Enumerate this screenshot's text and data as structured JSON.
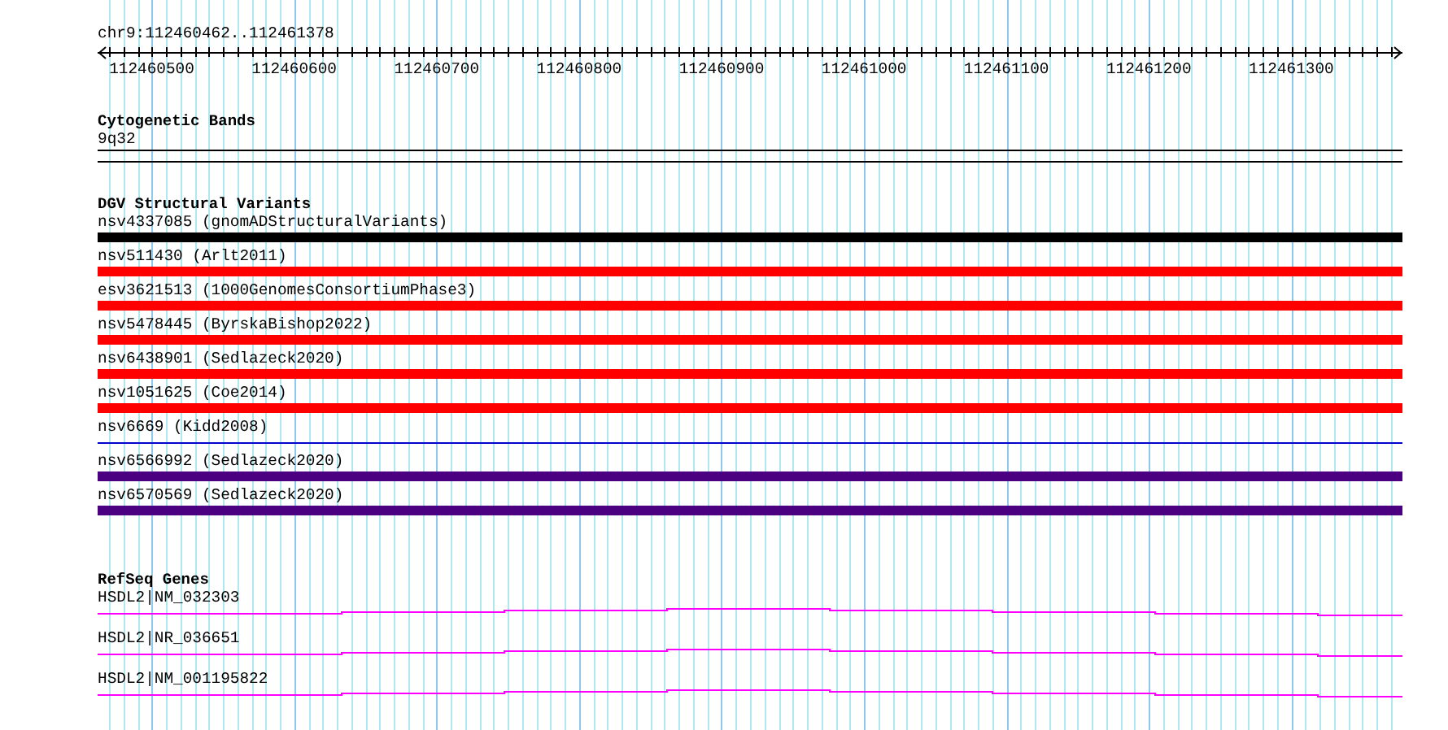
{
  "location": "chr9:112460462..112461378",
  "ruler": {
    "ticks": [
      "112460500",
      "112460600",
      "112460700",
      "112460800",
      "112460900",
      "112461000",
      "112461100",
      "112461200",
      "112461300"
    ]
  },
  "tracks": [
    {
      "kind": "bands",
      "title": "Cytogenetic Bands",
      "features": [
        {
          "label": "9q32"
        }
      ]
    },
    {
      "kind": "variants",
      "title": "DGV Structural Variants",
      "features": [
        {
          "label": "nsv4337085 (gnomADStructuralVariants)",
          "color": "#000000",
          "kind": "thick"
        },
        {
          "label": "nsv511430 (Arlt2011)",
          "color": "#ff0000",
          "kind": "thick"
        },
        {
          "label": "esv3621513 (1000GenomesConsortiumPhase3)",
          "color": "#ff0000",
          "kind": "thick"
        },
        {
          "label": "nsv5478445 (ByrskaBishop2022)",
          "color": "#ff0000",
          "kind": "thick"
        },
        {
          "label": "nsv6438901 (Sedlazeck2020)",
          "color": "#ff0000",
          "kind": "thick"
        },
        {
          "label": "nsv1051625 (Coe2014)",
          "color": "#ff0000",
          "kind": "thick"
        },
        {
          "label": "nsv6669 (Kidd2008)",
          "color": "#0000cc",
          "kind": "thin"
        },
        {
          "label": "nsv6566992 (Sedlazeck2020)",
          "color": "#4b0082",
          "kind": "thick"
        },
        {
          "label": "nsv6570569 (Sedlazeck2020)",
          "color": "#4b0082",
          "kind": "thick"
        }
      ]
    },
    {
      "kind": "genes",
      "title": "RefSeq Genes",
      "features": [
        {
          "label": "HSDL2|NM_032303"
        },
        {
          "label": "HSDL2|NR_036651"
        },
        {
          "label": "HSDL2|NM_001195822"
        }
      ]
    }
  ]
}
